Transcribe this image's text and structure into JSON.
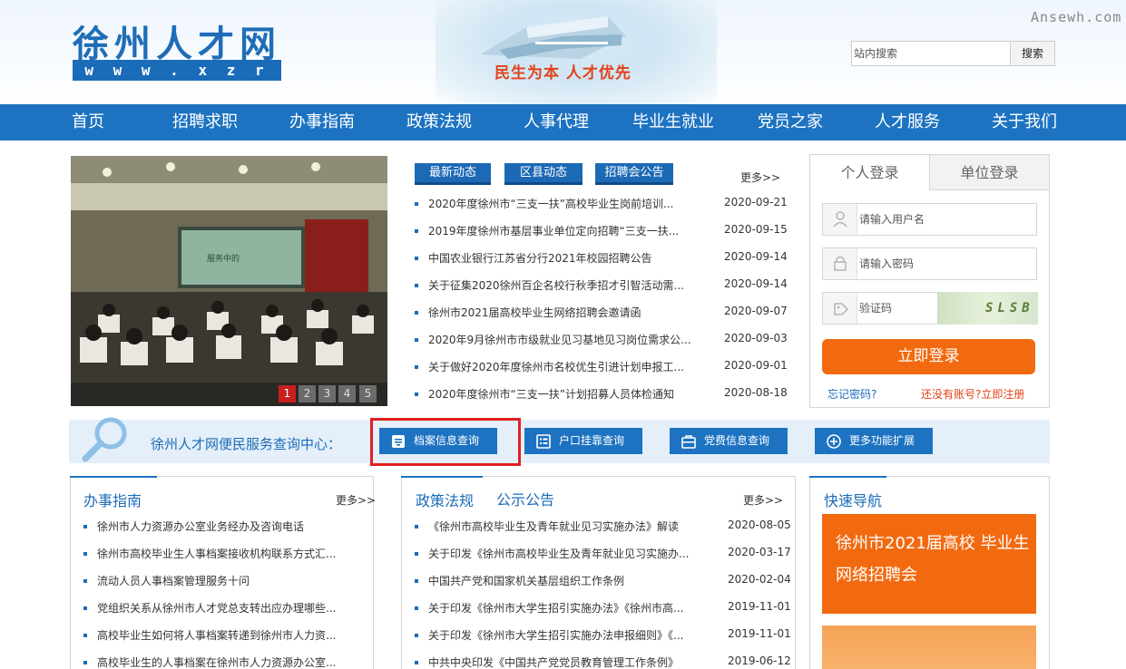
{
  "header": {
    "logo_cn": "徐州人才网",
    "logo_url": "w w w . x z r c . c o m",
    "slogan": "民生为本 人才优先",
    "watermark": "Ansewh.com",
    "search_placeholder": "站内搜索",
    "search_button": "搜索"
  },
  "nav": {
    "items": [
      "首页",
      "招聘求职",
      "办事指南",
      "政策法规",
      "人事代理",
      "毕业生就业",
      "党员之家",
      "人才服务",
      "关于我们"
    ]
  },
  "slideshow": {
    "screen_text": "服务中的",
    "pages": [
      "1",
      "2",
      "3",
      "4",
      "5"
    ],
    "active_page": "1"
  },
  "news": {
    "tabs": [
      "最新动态",
      "区县动态",
      "招聘会公告"
    ],
    "more": "更多>>",
    "items": [
      {
        "title": "2020年度徐州市“三支一扶”高校毕业生岗前培训...",
        "date": "2020-09-21"
      },
      {
        "title": "2019年度徐州市基层事业单位定向招聘“三支一扶...",
        "date": "2020-09-15"
      },
      {
        "title": "中国农业银行江苏省分行2021年校园招聘公告",
        "date": "2020-09-14"
      },
      {
        "title": "关于征集2020徐州百企名校行秋季招才引智活动需...",
        "date": "2020-09-14"
      },
      {
        "title": "徐州市2021届高校毕业生网络招聘会邀请函",
        "date": "2020-09-07"
      },
      {
        "title": "2020年9月徐州市市级就业见习基地见习岗位需求公...",
        "date": "2020-09-03"
      },
      {
        "title": "关于做好2020年度徐州市名校优生引进计划申报工...",
        "date": "2020-09-01"
      },
      {
        "title": "2020年度徐州市“三支一扶”计划招募人员体检通知",
        "date": "2020-08-18"
      }
    ]
  },
  "login": {
    "tab_personal": "个人登录",
    "tab_unit": "单位登录",
    "username_placeholder": "请输入用户名",
    "password_placeholder": "请输入密码",
    "captcha_placeholder": "验证码",
    "captcha_text": "SLSB",
    "login_button": "立即登录",
    "forgot": "忘记密码?",
    "register": "还没有账号?立即注册"
  },
  "service": {
    "title": "徐州人才网便民服务查询中心：",
    "buttons": [
      "档案信息查询",
      "户口挂靠查询",
      "党费信息查询",
      "更多功能扩展"
    ]
  },
  "guide": {
    "title": "办事指南",
    "more": "更多>>",
    "items": [
      "徐州市人力资源办公室业务经办及咨询电话",
      "徐州市高校毕业生人事档案接收机构联系方式汇...",
      "流动人员人事档案管理服务十问",
      "党组织关系从徐州市人才党总支转出应办理哪些...",
      "高校毕业生如何将人事档案转递到徐州市人力资...",
      "高校毕业生的人事档案在徐州市人力资源办公室..."
    ]
  },
  "policy": {
    "title": "政策法规",
    "title2": "公示公告",
    "more": "更多>>",
    "items": [
      {
        "title": "《徐州市高校毕业生及青年就业见习实施办法》解读",
        "date": "2020-08-05"
      },
      {
        "title": "关于印发《徐州市高校毕业生及青年就业见习实施办...",
        "date": "2020-03-17"
      },
      {
        "title": "中国共产党和国家机关基层组织工作条例",
        "date": "2020-02-04"
      },
      {
        "title": "关于印发《徐州市大学生招引实施办法》《徐州市高...",
        "date": "2019-11-01"
      },
      {
        "title": "关于印发《徐州市大学生招引实施办法申报细则》《...",
        "date": "2019-11-01"
      },
      {
        "title": "中共中央印发《中国共产党党员教育管理工作条例》",
        "date": "2019-06-12"
      }
    ]
  },
  "quicknav": {
    "title": "快速导航",
    "promo": "徐州市2021届高校 毕业生网络招聘会"
  },
  "colors": {
    "primary": "#1d73c1",
    "accent": "#f26a10",
    "highlight": "#e02020"
  }
}
